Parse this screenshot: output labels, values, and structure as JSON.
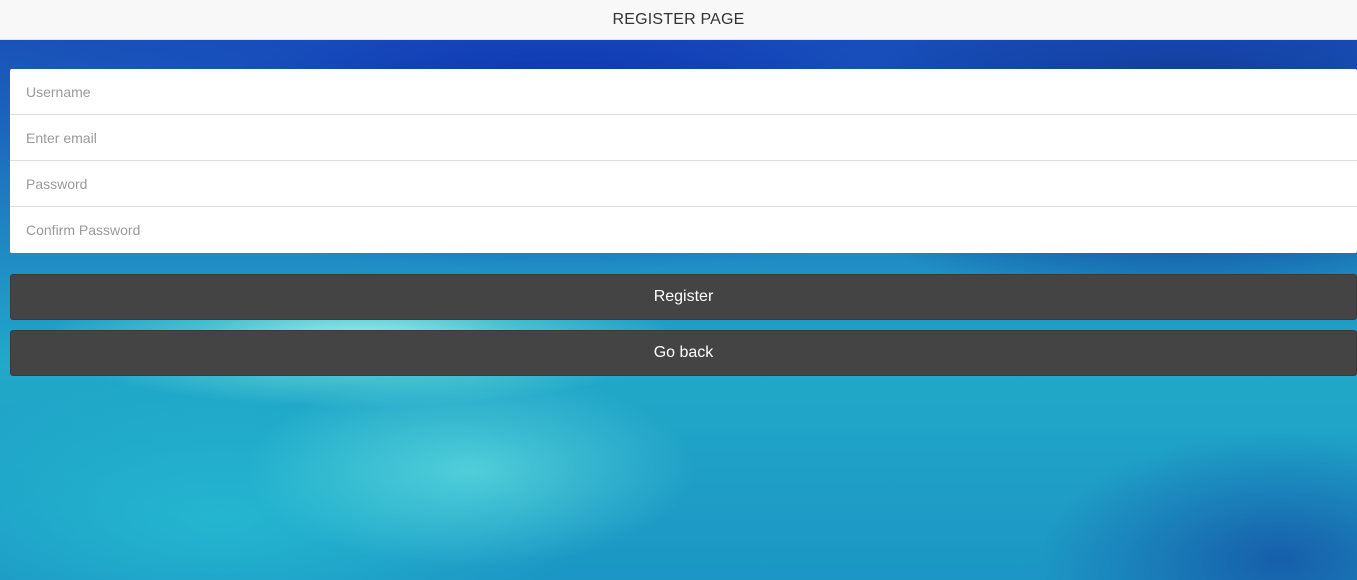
{
  "header": {
    "title": "REGISTER PAGE"
  },
  "form": {
    "fields": [
      {
        "placeholder": "Username",
        "value": ""
      },
      {
        "placeholder": "Enter email",
        "value": ""
      },
      {
        "placeholder": "Password",
        "value": ""
      },
      {
        "placeholder": "Confirm Password",
        "value": ""
      }
    ],
    "register_label": "Register",
    "back_label": "Go back"
  },
  "colors": {
    "header_bg": "#f8f8f8",
    "button_bg": "#444444",
    "button_text": "#ffffff"
  }
}
